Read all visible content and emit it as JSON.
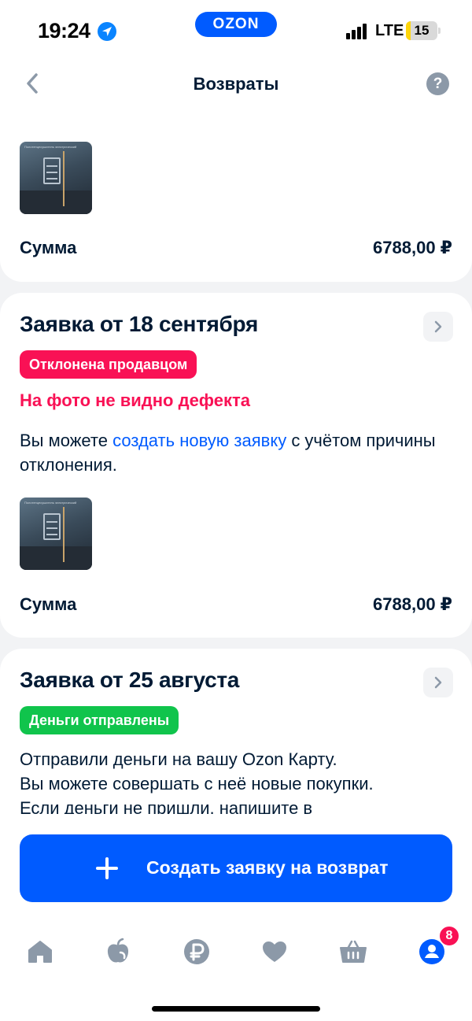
{
  "status_bar": {
    "time": "19:24",
    "logo": "OZON",
    "network": "LTE",
    "battery": "15",
    "battery_level": 0.15
  },
  "header": {
    "title": "Возвраты",
    "back_icon": "chevron-left-icon",
    "help_label": "?"
  },
  "cards": [
    {
      "sum_label": "Сумма",
      "sum_value": "6788,00 ₽"
    },
    {
      "title": "Заявка от 18 сентября",
      "status": "Отклонена продавцом",
      "status_color": "#f91155",
      "reason": "На фото не видно дефекта",
      "desc_before": "Вы можете ",
      "desc_link": "создать новую заявку",
      "desc_after": " с учётом причины отклонения.",
      "sum_label": "Сумма",
      "sum_value": "6788,00 ₽"
    },
    {
      "title": "Заявка от 25 августа",
      "status": "Деньги отправлены",
      "status_color": "#10c44c",
      "desc_lines": [
        "Отправили деньги на вашу Ozon Карту.",
        "Вы можете совершать с неё новые покупки.",
        "Если деньги не пришли, напишите в"
      ]
    }
  ],
  "bottom": {
    "create_button": "Создать заявку на возврат",
    "tabs": [
      "home-icon",
      "fresh-icon",
      "ruble-icon",
      "heart-icon",
      "basket-icon",
      "profile-icon"
    ],
    "profile_badge": "8"
  },
  "colors": {
    "accent": "#005bff",
    "danger": "#f91155",
    "success": "#10c44c",
    "text": "#001a34"
  }
}
